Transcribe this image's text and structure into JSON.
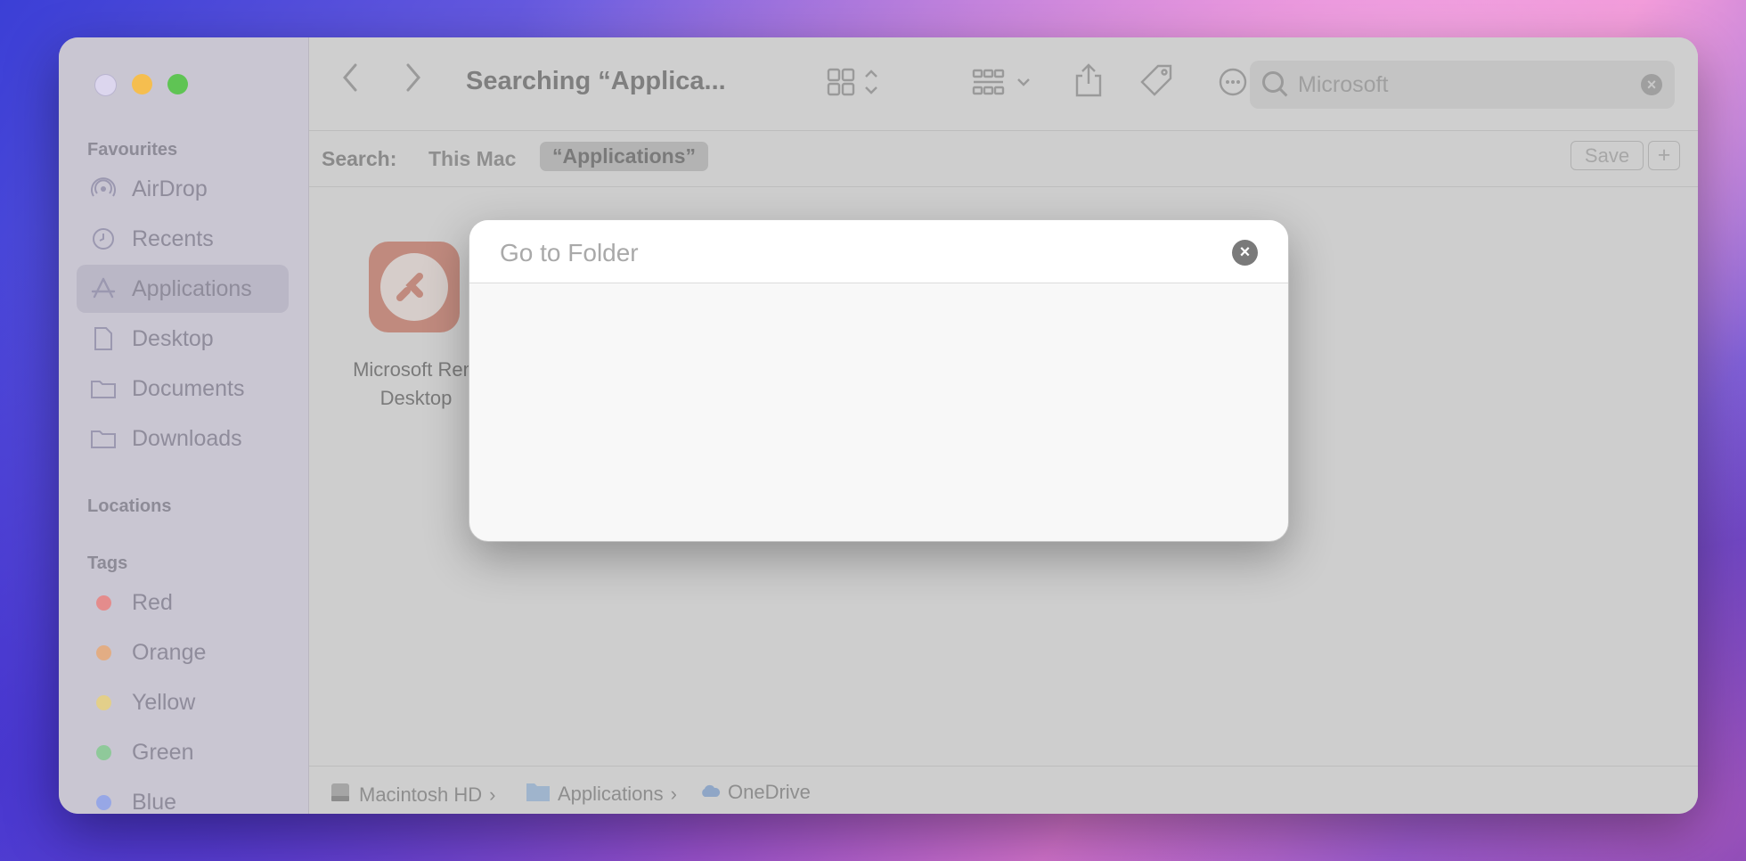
{
  "window": {
    "title": "Searching “Applica...",
    "traffic_lights": [
      "#dcd6ee",
      "#f5be4f",
      "#5fc454"
    ]
  },
  "sidebar": {
    "favourites_heading": "Favourites",
    "favourites": [
      {
        "label": "AirDrop",
        "icon": "airdrop-icon"
      },
      {
        "label": "Recents",
        "icon": "clock-icon"
      },
      {
        "label": "Applications",
        "icon": "applications-icon",
        "selected": true
      },
      {
        "label": "Desktop",
        "icon": "document-icon"
      },
      {
        "label": "Documents",
        "icon": "folder-icon"
      },
      {
        "label": "Downloads",
        "icon": "folder-icon"
      }
    ],
    "locations_heading": "Locations",
    "tags_heading": "Tags",
    "tags": [
      {
        "label": "Red",
        "color": "#e48c8c"
      },
      {
        "label": "Orange",
        "color": "#e2ad84"
      },
      {
        "label": "Yellow",
        "color": "#e3cf8a"
      },
      {
        "label": "Green",
        "color": "#8fc99a"
      },
      {
        "label": "Blue",
        "color": "#97a7e6"
      }
    ]
  },
  "search": {
    "value": "Microsoft",
    "scope_label": "Search:",
    "scope_this_mac": "This Mac",
    "scope_applications": "“Applications”",
    "save_label": "Save",
    "add_label": "+"
  },
  "content": {
    "items": [
      {
        "name": "Microsoft Rem\nDesktop",
        "icon": "remote-desktop-icon"
      }
    ]
  },
  "pathbar": {
    "segments": [
      "Macintosh HD",
      "Applications",
      "OneDrive"
    ]
  },
  "dialog": {
    "placeholder": "Go to Folder",
    "close_icon": "close-icon"
  }
}
